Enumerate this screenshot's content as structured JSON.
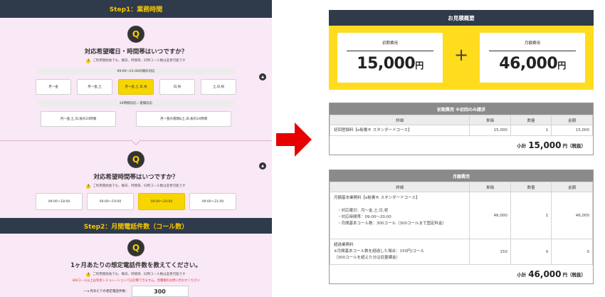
{
  "left": {
    "step1": {
      "title": "Step1：業務時間"
    },
    "q1": {
      "icon": "Q",
      "title": "対応希望曜日・時間帯はいつですか？",
      "note": "ご利用開始後でも、曜日、時間帯、同時コール数は変更可能です",
      "section_a": "09:00〜21:00の間の対応",
      "options_a": [
        "月〜金",
        "月〜金,土",
        "月〜金,土,日,祝",
        "日,祝",
        "土,日,祝"
      ],
      "selected_a": 2,
      "section_b": "24時間対応・夜間対応",
      "options_b": [
        "月〜金,土,日,祝の24時間",
        "月〜金の夜間&土,日,祝の24時間"
      ]
    },
    "q2": {
      "icon": "Q",
      "title": "対応希望時間帯はいつですか？",
      "note": "ご利用開始後でも、曜日、時間帯、同時コール数は変更可能です",
      "options": [
        "09:00〜18:00",
        "09:00〜19:00",
        "09:00〜20:00",
        "09:00〜21:00"
      ],
      "selected": 2
    },
    "step2": {
      "title": "Step2：月間電話件数（コール数）"
    },
    "q3": {
      "icon": "Q",
      "title": "1ヶ月あたりの想定電話件数を教えてください。",
      "note": "ご利用開始後でも、曜日、時間帯、同時コール数は変更可能です",
      "red_note": "300コール以上は料金シミュレーションでは計算できません。見積額のお問い合わせください",
      "input_label": "一ヶ月あたりの想定電話件数：",
      "input_value": "300"
    },
    "collapse_icon": "▲"
  },
  "summary": {
    "title": "お見積概要",
    "initial_label": "初期費用",
    "initial_amount": "15,000",
    "monthly_label": "月額費用",
    "monthly_amount": "46,000",
    "yen": "円",
    "plus": "+"
  },
  "initial_table": {
    "title": "初期費用 ※初回のみ請求",
    "headers": [
      "詳細",
      "単価",
      "数量",
      "金額"
    ],
    "rows": [
      {
        "detail": "初回登録料【e秘書® スタンダードコース】",
        "unit": "15,000",
        "qty": "1",
        "amount": "15,000"
      }
    ],
    "subtotal_label": "小計",
    "subtotal_amount": "15,000",
    "subtotal_suffix": "円（税抜）"
  },
  "monthly_table": {
    "title": "月額費用",
    "headers": [
      "詳細",
      "単価",
      "数量",
      "金額"
    ],
    "row1": {
      "line1": "月額基本業務料【e秘書® スタンダードコース】",
      "line2": "・対応曜日：月〜金,土,日,祝",
      "line3": "・対応時間帯：09:00〜20:00",
      "line4": "・月間基本コール数：300コール（300コールまで固定料金）",
      "unit": "46,000",
      "qty": "1",
      "amount": "46,000"
    },
    "row2": {
      "line1": "超過業務料",
      "line2": "※月間基本コール数を超過した場合：150円/コール",
      "line3": "（300コールを超えた分は従量課金）",
      "unit": "150",
      "qty": "0",
      "amount": "0"
    },
    "subtotal_label": "小計",
    "subtotal_amount": "46,000",
    "subtotal_suffix": "円（税抜）"
  },
  "colors": {
    "navy": "#2f3a4a",
    "yellow": "#ffdc1e",
    "pink": "#f9e8f5",
    "red_arrow": "#e60000"
  }
}
